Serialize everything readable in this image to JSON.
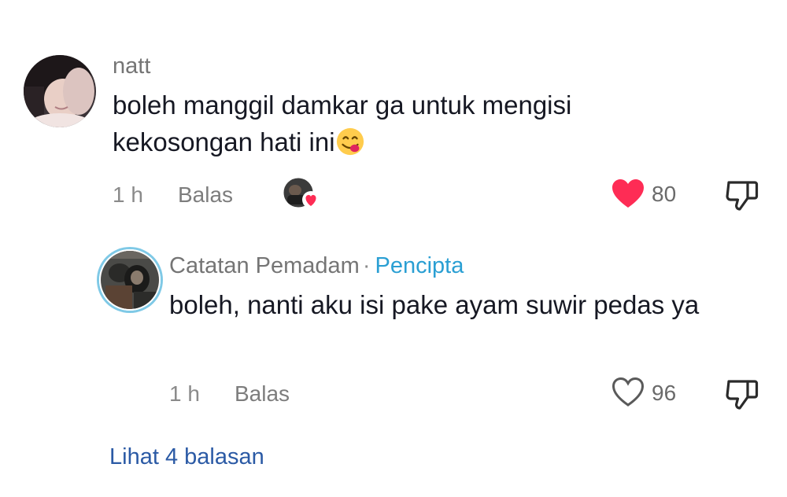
{
  "comment": {
    "username": "natt",
    "text": "boleh manggil damkar ga untuk mengisi kekosongan hati ini",
    "emoji": "yum-face",
    "time": "1 h",
    "reply_label": "Balas",
    "like_count": "80",
    "liked": true,
    "like_color": "#fe2c55"
  },
  "reply": {
    "username": "Catatan Pemadam",
    "separator": "·",
    "creator_badge": "Pencipta",
    "text": "boleh, nanti aku isi pake ayam suwir pedas ya",
    "time": "1 h",
    "reply_label": "Balas",
    "like_count": "96",
    "liked": false,
    "badge_color": "#2a9fd3"
  },
  "view_replies_label": "Lihat 4 balasan",
  "icons": {
    "like": "heart-icon",
    "dislike": "thumbs-down-icon",
    "creator_liked": "creator-liked-avatar-icon"
  }
}
